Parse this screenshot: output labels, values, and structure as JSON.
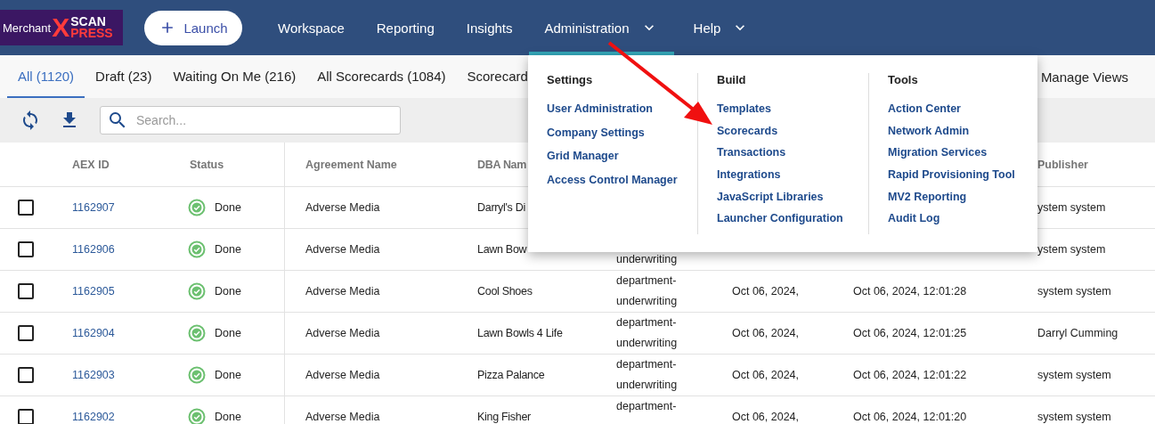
{
  "header": {
    "logo": {
      "word": "Merchant",
      "mark": "X",
      "top": "SCAN",
      "bottom": "PRESS"
    },
    "launch": "Launch",
    "nav": [
      {
        "label": "Workspace",
        "selected": false,
        "has_menu": false
      },
      {
        "label": "Reporting",
        "selected": false,
        "has_menu": false
      },
      {
        "label": "Insights",
        "selected": false,
        "has_menu": false
      },
      {
        "label": "Administration",
        "selected": true,
        "has_menu": true
      },
      {
        "label": "Help",
        "selected": false,
        "has_menu": true
      }
    ]
  },
  "view_tabs": [
    {
      "label": "All (1120)",
      "selected": true
    },
    {
      "label": "Draft (23)",
      "selected": false
    },
    {
      "label": "Waiting On Me (216)",
      "selected": false
    },
    {
      "label": "All Scorecards (1084)",
      "selected": false
    },
    {
      "label": "Scorecard",
      "selected": false
    }
  ],
  "manage_views": "Manage Views",
  "toolbar": {
    "search": {
      "placeholder": "Search..."
    }
  },
  "table": {
    "columns": {
      "aex_id": "AEX ID",
      "status": "Status",
      "agreement_name": "Agreement Name",
      "dba_name": "DBA Nam",
      "publisher": "Publisher"
    },
    "rows": [
      {
        "checked": false,
        "aex_id": "1162907",
        "status": {
          "label": "Done",
          "kind": "done"
        },
        "agreement_name": "Adverse Media",
        "dba_name": "Darryl's Di",
        "publisher": "ystem system"
      },
      {
        "checked": false,
        "aex_id": "1162906",
        "status": {
          "label": "Done",
          "kind": "done"
        },
        "agreement_name": "Adverse Media",
        "dba_name": "Lawn Bow",
        "column_6": "underwriting",
        "publisher": "ystem system"
      },
      {
        "checked": false,
        "aex_id": "1162905",
        "status": {
          "label": "Done",
          "kind": "done"
        },
        "agreement_name": "Adverse Media",
        "dba_name": "Cool Shoes",
        "column_6": "department-underwriting",
        "column_7": "Oct 06, 2024,",
        "column_8": "Oct 06, 2024, 12:01:28",
        "publisher": "system system"
      },
      {
        "checked": false,
        "aex_id": "1162904",
        "status": {
          "label": "Done",
          "kind": "done"
        },
        "agreement_name": "Adverse Media",
        "dba_name": "Lawn Bowls 4 Life",
        "column_6": "department-underwriting",
        "column_7": "Oct 06, 2024,",
        "column_8": "Oct 06, 2024, 12:01:25",
        "publisher": "Darryl Cumming"
      },
      {
        "checked": false,
        "aex_id": "1162903",
        "status": {
          "label": "Done",
          "kind": "done"
        },
        "agreement_name": "Adverse Media",
        "dba_name": "Pizza Palance",
        "column_6": "department-underwriting",
        "column_7": "Oct 06, 2024,",
        "column_8": "Oct 06, 2024, 12:01:22",
        "publisher": "system system"
      },
      {
        "checked": false,
        "aex_id": "1162902",
        "status": {
          "label": "Done",
          "kind": "done"
        },
        "agreement_name": "Adverse Media",
        "dba_name": "King Fisher",
        "column_6": "department-",
        "column_7": "Oct 06, 2024,",
        "column_8": "Oct 06, 2024, 12:01:20",
        "publisher": "system system"
      }
    ]
  },
  "admin_menu": {
    "sections": [
      {
        "title": "Settings",
        "items": [
          "User Administration",
          "Company Settings",
          "Grid Manager",
          "Access Control Manager"
        ]
      },
      {
        "title": "Build",
        "items": [
          "Templates",
          "Scorecards",
          "Transactions",
          "Integrations",
          "JavaScript Libraries",
          "Launcher Configuration"
        ]
      },
      {
        "title": "Tools",
        "items": [
          "Action Center",
          "Network Admin",
          "Migration Services",
          "Rapid Provisioning Tool",
          "MV2 Reporting",
          "Audit Log"
        ]
      }
    ]
  }
}
